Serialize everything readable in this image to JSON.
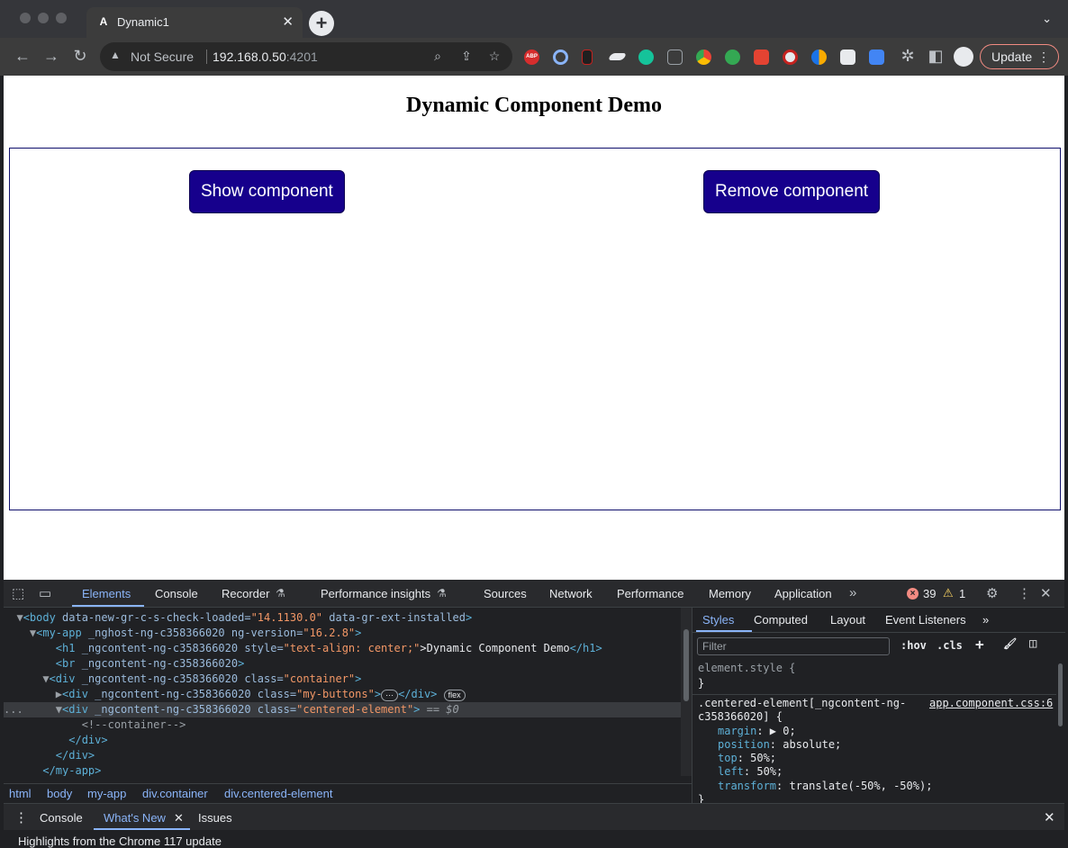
{
  "browser": {
    "tab_title": "Dynamic1",
    "tab_favicon": "A",
    "url_security": "Not Secure",
    "url_host": "192.168.0.50",
    "url_port": ":4201",
    "ext_abp": "ABP",
    "update_label": "Update"
  },
  "page": {
    "title": "Dynamic Component Demo",
    "show_button": "Show component",
    "remove_button": "Remove component"
  },
  "devtools": {
    "tabs": [
      "Elements",
      "Console",
      "Recorder",
      "Performance insights",
      "Sources",
      "Network",
      "Performance",
      "Memory",
      "Application"
    ],
    "error_count": "39",
    "warning_count": "1",
    "dom_lines": {
      "l1_tag": "<body",
      "l1_attr": " data-new-gr-c-s-check-loaded=",
      "l1_val": "\"14.1130.0\"",
      "l1_attr2": " data-gr-ext-installed",
      "l1_end": ">",
      "l2_tag": "<my-app",
      "l2_attr": " _nghost-ng-c358366020 ng-version=",
      "l2_val": "\"16.2.8\"",
      "l2_end": ">",
      "l3_tag": "<h1",
      "l3_attr": " _ngcontent-ng-c358366020 style=",
      "l3_val": "\"text-align: center;\"",
      "l3_text": ">Dynamic Component Demo",
      "l3_close": "</h1>",
      "l4_tag": "<br",
      "l4_attr": " _ngcontent-ng-c358366020",
      "l4_end": ">",
      "l5_tag": "<div",
      "l5_attr": " _ngcontent-ng-c358366020 class=",
      "l5_val": "\"container\"",
      "l5_end": ">",
      "l6_tag": "<div",
      "l6_attr": " _ngcontent-ng-c358366020 class=",
      "l6_val": "\"my-buttons\"",
      "l6_end": ">",
      "l6_ellipsis": "⋯",
      "l6_close": "</div>",
      "l6_badge": "flex",
      "l7_tag": "<div",
      "l7_attr": " _ngcontent-ng-c358366020 class=",
      "l7_val": "\"centered-element\"",
      "l7_end": ">",
      "l7_eq": " == $0",
      "l8_comment": "<!--container-->",
      "l9_close": "</div>",
      "l10_close": "</div>",
      "l11_close": "</my-app>"
    },
    "breadcrumbs": [
      "html",
      "body",
      "my-app",
      "div.container",
      "div.centered-element"
    ],
    "styles_tabs": [
      "Styles",
      "Computed",
      "Layout",
      "Event Listeners"
    ],
    "filter_placeholder": "Filter",
    "hov": ":hov",
    "cls": ".cls",
    "css": {
      "element_style": "element.style {",
      "close_brace": "}",
      "selector_1": ".centered-element[_ngcontent-ng-",
      "selector_2": "c358366020] {",
      "source": "app.component.css:6",
      "margin_prop": "margin",
      "margin_val": ": ▶ 0;",
      "position_prop": "position",
      "position_val": ": absolute;",
      "top_prop": "top",
      "top_val": ": 50%;",
      "left_prop": "left",
      "left_val": ": 50%;",
      "transform_prop": "transform",
      "transform_val": ": translate(-50%, -50%);"
    },
    "drawer_tabs": [
      "Console",
      "What's New",
      "Issues"
    ],
    "drawer_text": "Highlights from the Chrome 117 update"
  }
}
